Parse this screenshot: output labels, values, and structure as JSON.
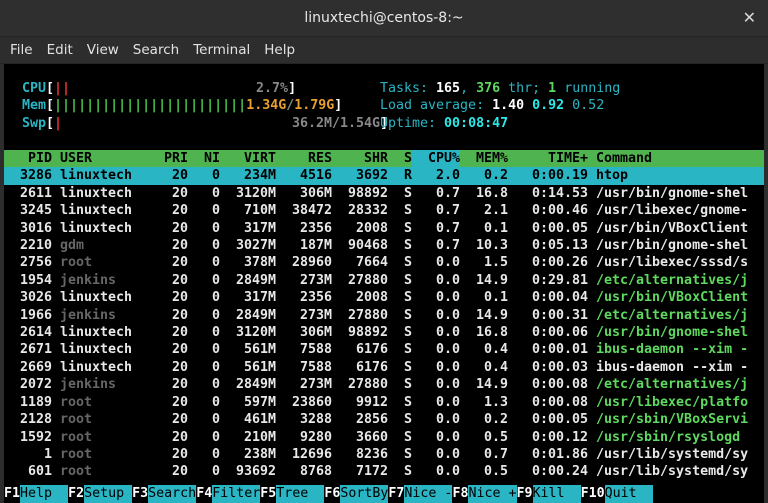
{
  "window": {
    "title": "linuxtechi@centos-8:~",
    "close_glyph": "✕"
  },
  "menu": [
    "File",
    "Edit",
    "View",
    "Search",
    "Terminal",
    "Help"
  ],
  "meters": {
    "cpu": {
      "label": "CPU",
      "bar": "||",
      "value": "2.7%"
    },
    "mem": {
      "label": "Mem",
      "bar": "||||||||||||||||||||||||",
      "used": "1.34G",
      "total": "1.79G"
    },
    "swp": {
      "label": "Swp",
      "bar": "|",
      "value": "36.2M/1.54G"
    }
  },
  "stats": {
    "tasks_label": "Tasks: ",
    "tasks": "165",
    "threads": "376",
    "thr_label": " thr; ",
    "running": "1",
    "running_label": " running",
    "load_label": "Load average: ",
    "load1": "1.40",
    "load5": "0.92",
    "load15": "0.52",
    "uptime_label": "Uptime: ",
    "uptime": "00:08:47"
  },
  "columns": [
    "PID",
    "USER",
    "PRI",
    "NI",
    "VIRT",
    "RES",
    "SHR",
    "S",
    "CPU%",
    "MEM%",
    "TIME+",
    "Command"
  ],
  "processes": [
    {
      "pid": "3286",
      "user": "linuxtech",
      "pri": "20",
      "ni": "0",
      "virt": "234M",
      "res": "4516",
      "shr": "3692",
      "s": "R",
      "cpu": "2.0",
      "mem": "0.2",
      "time": "0:00.19",
      "cmd": "htop"
    },
    {
      "pid": "2611",
      "user": "linuxtech",
      "pri": "20",
      "ni": "0",
      "virt": "3120M",
      "res": "306M",
      "shr": "98892",
      "s": "S",
      "cpu": "0.7",
      "mem": "16.8",
      "time": "0:14.53",
      "cmd": "/usr/bin/gnome-shel"
    },
    {
      "pid": "3245",
      "user": "linuxtech",
      "pri": "20",
      "ni": "0",
      "virt": "710M",
      "res": "38472",
      "shr": "28332",
      "s": "S",
      "cpu": "0.7",
      "mem": "2.1",
      "time": "0:00.46",
      "cmd": "/usr/libexec/gnome-"
    },
    {
      "pid": "3016",
      "user": "linuxtech",
      "pri": "20",
      "ni": "0",
      "virt": "317M",
      "res": "2356",
      "shr": "2008",
      "s": "S",
      "cpu": "0.7",
      "mem": "0.1",
      "time": "0:00.05",
      "cmd": "/usr/bin/VBoxClient"
    },
    {
      "pid": "2210",
      "user": "gdm",
      "pri": "20",
      "ni": "0",
      "virt": "3027M",
      "res": "187M",
      "shr": "90468",
      "s": "S",
      "cpu": "0.7",
      "mem": "10.3",
      "time": "0:05.13",
      "cmd": "/usr/bin/gnome-shel"
    },
    {
      "pid": "2756",
      "user": "root",
      "pri": "20",
      "ni": "0",
      "virt": "378M",
      "res": "28960",
      "shr": "7664",
      "s": "S",
      "cpu": "0.0",
      "mem": "1.5",
      "time": "0:00.26",
      "cmd": "/usr/libexec/sssd/s"
    },
    {
      "pid": "1954",
      "user": "jenkins",
      "pri": "20",
      "ni": "0",
      "virt": "2849M",
      "res": "273M",
      "shr": "27880",
      "s": "S",
      "cpu": "0.0",
      "mem": "14.9",
      "time": "0:29.81",
      "cmd": "/etc/alternatives/j"
    },
    {
      "pid": "3026",
      "user": "linuxtech",
      "pri": "20",
      "ni": "0",
      "virt": "317M",
      "res": "2356",
      "shr": "2008",
      "s": "S",
      "cpu": "0.0",
      "mem": "0.1",
      "time": "0:00.04",
      "cmd": "/usr/bin/VBoxClient"
    },
    {
      "pid": "1966",
      "user": "jenkins",
      "pri": "20",
      "ni": "0",
      "virt": "2849M",
      "res": "273M",
      "shr": "27880",
      "s": "S",
      "cpu": "0.0",
      "mem": "14.9",
      "time": "0:00.31",
      "cmd": "/etc/alternatives/j"
    },
    {
      "pid": "2614",
      "user": "linuxtech",
      "pri": "20",
      "ni": "0",
      "virt": "3120M",
      "res": "306M",
      "shr": "98892",
      "s": "S",
      "cpu": "0.0",
      "mem": "16.8",
      "time": "0:00.06",
      "cmd": "/usr/bin/gnome-shel"
    },
    {
      "pid": "2671",
      "user": "linuxtech",
      "pri": "20",
      "ni": "0",
      "virt": "561M",
      "res": "7588",
      "shr": "6176",
      "s": "S",
      "cpu": "0.0",
      "mem": "0.4",
      "time": "0:00.01",
      "cmd": "ibus-daemon --xim -"
    },
    {
      "pid": "2669",
      "user": "linuxtech",
      "pri": "20",
      "ni": "0",
      "virt": "561M",
      "res": "7588",
      "shr": "6176",
      "s": "S",
      "cpu": "0.0",
      "mem": "0.4",
      "time": "0:00.03",
      "cmd": "ibus-daemon --xim -"
    },
    {
      "pid": "2072",
      "user": "jenkins",
      "pri": "20",
      "ni": "0",
      "virt": "2849M",
      "res": "273M",
      "shr": "27880",
      "s": "S",
      "cpu": "0.0",
      "mem": "14.9",
      "time": "0:00.08",
      "cmd": "/etc/alternatives/j"
    },
    {
      "pid": "1189",
      "user": "root",
      "pri": "20",
      "ni": "0",
      "virt": "597M",
      "res": "23860",
      "shr": "9912",
      "s": "S",
      "cpu": "0.0",
      "mem": "1.3",
      "time": "0:00.08",
      "cmd": "/usr/libexec/platfo"
    },
    {
      "pid": "2128",
      "user": "root",
      "pri": "20",
      "ni": "0",
      "virt": "461M",
      "res": "3288",
      "shr": "2856",
      "s": "S",
      "cpu": "0.0",
      "mem": "0.2",
      "time": "0:00.05",
      "cmd": "/usr/sbin/VBoxServi"
    },
    {
      "pid": "1592",
      "user": "root",
      "pri": "20",
      "ni": "0",
      "virt": "210M",
      "res": "9280",
      "shr": "3660",
      "s": "S",
      "cpu": "0.0",
      "mem": "0.5",
      "time": "0:00.12",
      "cmd": "/usr/sbin/rsyslogd"
    },
    {
      "pid": "1",
      "user": "root",
      "pri": "20",
      "ni": "0",
      "virt": "238M",
      "res": "12696",
      "shr": "8236",
      "s": "S",
      "cpu": "0.0",
      "mem": "0.7",
      "time": "0:01.86",
      "cmd": "/usr/lib/systemd/sy"
    },
    {
      "pid": "601",
      "user": "root",
      "pri": "20",
      "ni": "0",
      "virt": "93692",
      "res": "8768",
      "shr": "7172",
      "s": "S",
      "cpu": "0.0",
      "mem": "0.5",
      "time": "0:00.24",
      "cmd": "/usr/lib/systemd/sy"
    }
  ],
  "fkeys": [
    {
      "key": "F1",
      "label": "Help  "
    },
    {
      "key": "F2",
      "label": "Setup "
    },
    {
      "key": "F3",
      "label": "Search"
    },
    {
      "key": "F4",
      "label": "Filter"
    },
    {
      "key": "F5",
      "label": "Tree  "
    },
    {
      "key": "F6",
      "label": "SortBy"
    },
    {
      "key": "F7",
      "label": "Nice -"
    },
    {
      "key": "F8",
      "label": "Nice +"
    },
    {
      "key": "F9",
      "label": "Kill  "
    },
    {
      "key": "F10",
      "label": "Quit  "
    }
  ],
  "colors": {
    "header_bar": "#4fb34f",
    "selected_row": "#2ab5c4",
    "cyan": "#2ab5c4"
  }
}
